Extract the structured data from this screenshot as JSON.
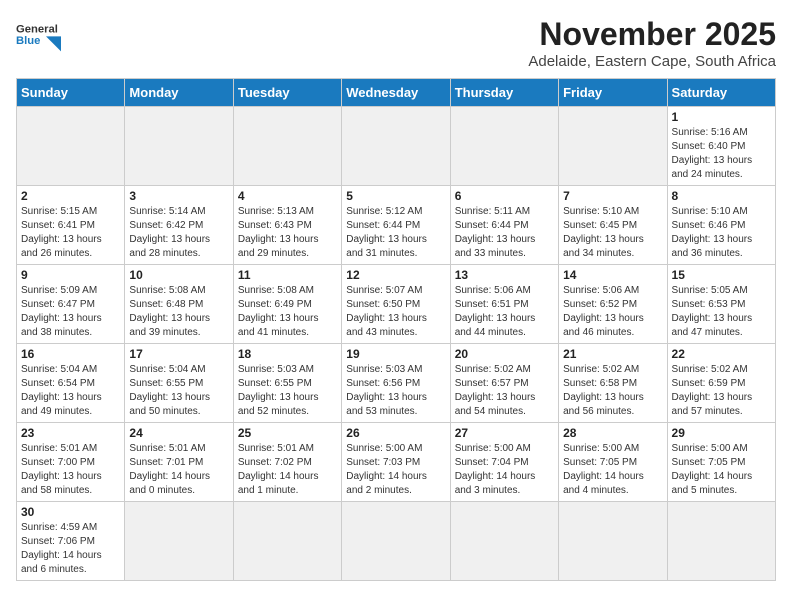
{
  "header": {
    "logo_general": "General",
    "logo_blue": "Blue",
    "month_title": "November 2025",
    "location": "Adelaide, Eastern Cape, South Africa"
  },
  "days_of_week": [
    "Sunday",
    "Monday",
    "Tuesday",
    "Wednesday",
    "Thursday",
    "Friday",
    "Saturday"
  ],
  "weeks": [
    [
      {
        "day": "",
        "empty": true
      },
      {
        "day": "",
        "empty": true
      },
      {
        "day": "",
        "empty": true
      },
      {
        "day": "",
        "empty": true
      },
      {
        "day": "",
        "empty": true
      },
      {
        "day": "",
        "empty": true
      },
      {
        "day": "1",
        "sunrise": "5:16 AM",
        "sunset": "6:40 PM",
        "daylight": "13 hours and 24 minutes."
      }
    ],
    [
      {
        "day": "2",
        "sunrise": "5:15 AM",
        "sunset": "6:41 PM",
        "daylight": "13 hours and 26 minutes."
      },
      {
        "day": "3",
        "sunrise": "5:14 AM",
        "sunset": "6:42 PM",
        "daylight": "13 hours and 28 minutes."
      },
      {
        "day": "4",
        "sunrise": "5:13 AM",
        "sunset": "6:43 PM",
        "daylight": "13 hours and 29 minutes."
      },
      {
        "day": "5",
        "sunrise": "5:12 AM",
        "sunset": "6:44 PM",
        "daylight": "13 hours and 31 minutes."
      },
      {
        "day": "6",
        "sunrise": "5:11 AM",
        "sunset": "6:44 PM",
        "daylight": "13 hours and 33 minutes."
      },
      {
        "day": "7",
        "sunrise": "5:10 AM",
        "sunset": "6:45 PM",
        "daylight": "13 hours and 34 minutes."
      },
      {
        "day": "8",
        "sunrise": "5:10 AM",
        "sunset": "6:46 PM",
        "daylight": "13 hours and 36 minutes."
      }
    ],
    [
      {
        "day": "9",
        "sunrise": "5:09 AM",
        "sunset": "6:47 PM",
        "daylight": "13 hours and 38 minutes."
      },
      {
        "day": "10",
        "sunrise": "5:08 AM",
        "sunset": "6:48 PM",
        "daylight": "13 hours and 39 minutes."
      },
      {
        "day": "11",
        "sunrise": "5:08 AM",
        "sunset": "6:49 PM",
        "daylight": "13 hours and 41 minutes."
      },
      {
        "day": "12",
        "sunrise": "5:07 AM",
        "sunset": "6:50 PM",
        "daylight": "13 hours and 43 minutes."
      },
      {
        "day": "13",
        "sunrise": "5:06 AM",
        "sunset": "6:51 PM",
        "daylight": "13 hours and 44 minutes."
      },
      {
        "day": "14",
        "sunrise": "5:06 AM",
        "sunset": "6:52 PM",
        "daylight": "13 hours and 46 minutes."
      },
      {
        "day": "15",
        "sunrise": "5:05 AM",
        "sunset": "6:53 PM",
        "daylight": "13 hours and 47 minutes."
      }
    ],
    [
      {
        "day": "16",
        "sunrise": "5:04 AM",
        "sunset": "6:54 PM",
        "daylight": "13 hours and 49 minutes."
      },
      {
        "day": "17",
        "sunrise": "5:04 AM",
        "sunset": "6:55 PM",
        "daylight": "13 hours and 50 minutes."
      },
      {
        "day": "18",
        "sunrise": "5:03 AM",
        "sunset": "6:55 PM",
        "daylight": "13 hours and 52 minutes."
      },
      {
        "day": "19",
        "sunrise": "5:03 AM",
        "sunset": "6:56 PM",
        "daylight": "13 hours and 53 minutes."
      },
      {
        "day": "20",
        "sunrise": "5:02 AM",
        "sunset": "6:57 PM",
        "daylight": "13 hours and 54 minutes."
      },
      {
        "day": "21",
        "sunrise": "5:02 AM",
        "sunset": "6:58 PM",
        "daylight": "13 hours and 56 minutes."
      },
      {
        "day": "22",
        "sunrise": "5:02 AM",
        "sunset": "6:59 PM",
        "daylight": "13 hours and 57 minutes."
      }
    ],
    [
      {
        "day": "23",
        "sunrise": "5:01 AM",
        "sunset": "7:00 PM",
        "daylight": "13 hours and 58 minutes."
      },
      {
        "day": "24",
        "sunrise": "5:01 AM",
        "sunset": "7:01 PM",
        "daylight": "14 hours and 0 minutes."
      },
      {
        "day": "25",
        "sunrise": "5:01 AM",
        "sunset": "7:02 PM",
        "daylight": "14 hours and 1 minute."
      },
      {
        "day": "26",
        "sunrise": "5:00 AM",
        "sunset": "7:03 PM",
        "daylight": "14 hours and 2 minutes."
      },
      {
        "day": "27",
        "sunrise": "5:00 AM",
        "sunset": "7:04 PM",
        "daylight": "14 hours and 3 minutes."
      },
      {
        "day": "28",
        "sunrise": "5:00 AM",
        "sunset": "7:05 PM",
        "daylight": "14 hours and 4 minutes."
      },
      {
        "day": "29",
        "sunrise": "5:00 AM",
        "sunset": "7:05 PM",
        "daylight": "14 hours and 5 minutes."
      }
    ],
    [
      {
        "day": "30",
        "sunrise": "4:59 AM",
        "sunset": "7:06 PM",
        "daylight": "14 hours and 6 minutes."
      },
      {
        "day": "",
        "empty": true
      },
      {
        "day": "",
        "empty": true
      },
      {
        "day": "",
        "empty": true
      },
      {
        "day": "",
        "empty": true
      },
      {
        "day": "",
        "empty": true
      },
      {
        "day": "",
        "empty": true
      }
    ]
  ]
}
